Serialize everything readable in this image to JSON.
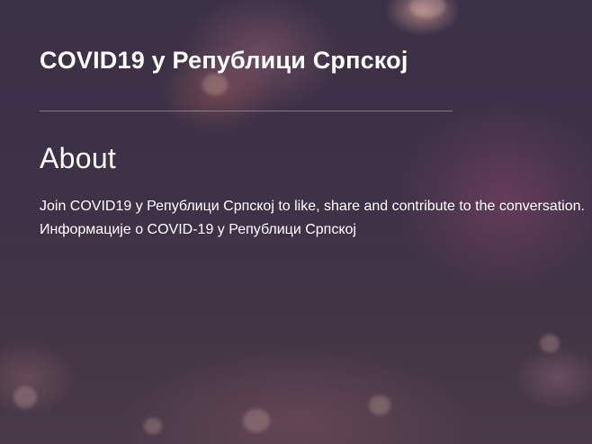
{
  "header": {
    "title": "COVID19 у Републици Српској"
  },
  "about": {
    "heading": "About",
    "join_text": "Join COVID19 у Републици Српској to like, share and contribute to the conversation.",
    "description": "Информације о COVID-19 у Републици Српској"
  },
  "colors": {
    "background": "#3b3147",
    "text": "#ffffff",
    "divider": "#8a8296"
  }
}
